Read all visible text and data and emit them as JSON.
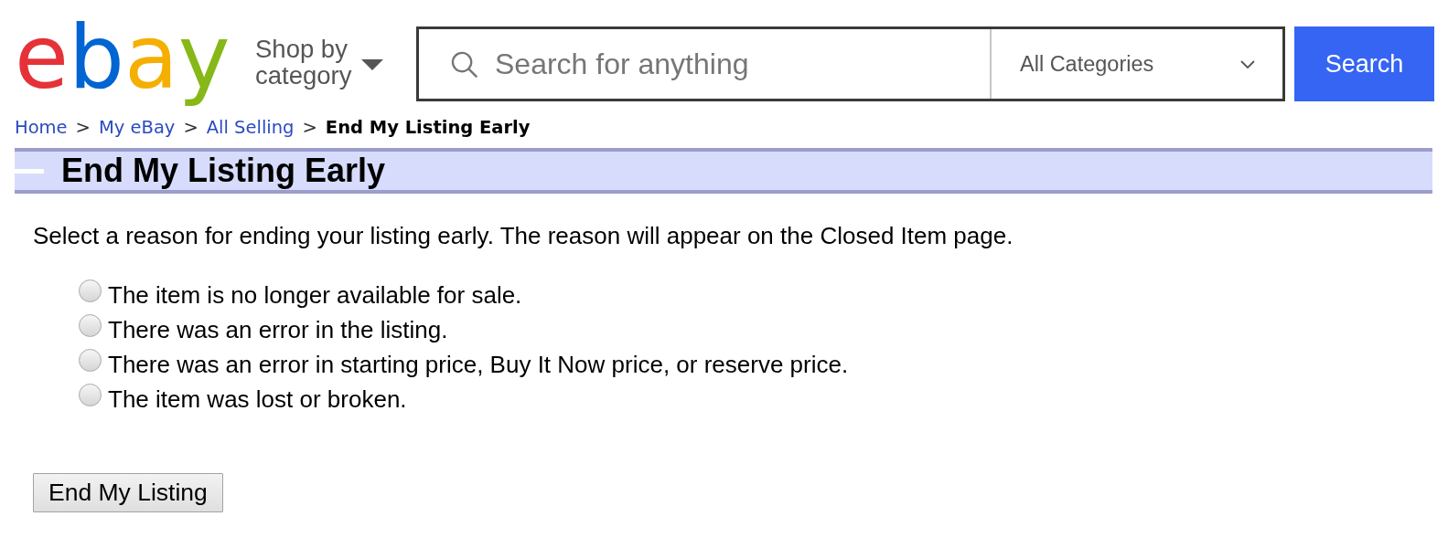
{
  "header": {
    "logo": [
      {
        "text": "e",
        "color": "#e53238"
      },
      {
        "text": "b",
        "color": "#0064d2"
      },
      {
        "text": "a",
        "color": "#f5af02"
      },
      {
        "text": "y",
        "color": "#86b817"
      }
    ],
    "shop_by_category": "Shop by category",
    "search": {
      "placeholder": "Search for anything",
      "category": "All Categories",
      "button": "Search"
    }
  },
  "breadcrumb": [
    {
      "label": "Home",
      "current": false,
      "separator": ">"
    },
    {
      "label": "My eBay",
      "current": false,
      "separator": ">"
    },
    {
      "label": "All Selling",
      "current": false,
      "separator": ">"
    },
    {
      "label": "End My Listing Early",
      "current": true
    }
  ],
  "page_title": "End My Listing Early",
  "instructions": "Select a reason for ending your listing early. The reason will appear on the Closed Item page.",
  "reasons": [
    {
      "label": "The item is no longer available for sale.",
      "selected": false
    },
    {
      "label": "There was an error in the listing.",
      "selected": false
    },
    {
      "label": "There was an error in starting price, Buy It Now price, or reserve price.",
      "selected": false
    },
    {
      "label": "The item was lost or broken.",
      "selected": false
    }
  ],
  "submit_button": "End My Listing"
}
